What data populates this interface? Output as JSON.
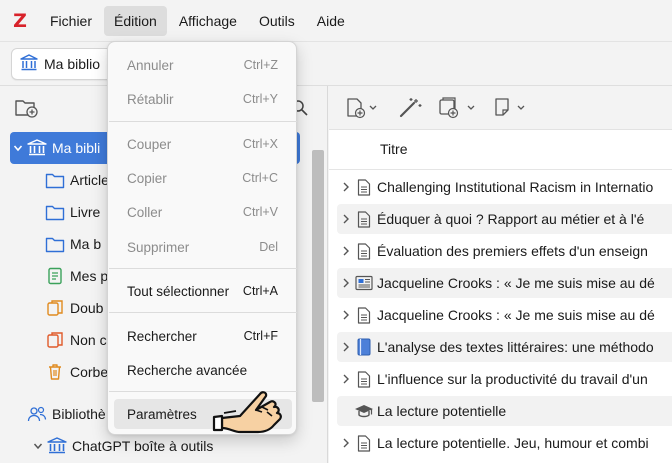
{
  "menubar": {
    "app_logo": "Z",
    "items": [
      {
        "label": "Fichier"
      },
      {
        "label": "Édition"
      },
      {
        "label": "Affichage"
      },
      {
        "label": "Outils"
      },
      {
        "label": "Aide"
      }
    ]
  },
  "tab": {
    "label": "Ma biblio"
  },
  "collections": {
    "items": [
      {
        "label": "Ma bibli",
        "icon": "library-icon"
      },
      {
        "label": "Article",
        "icon": "folder-icon"
      },
      {
        "label": "Livre",
        "icon": "folder-icon"
      },
      {
        "label": "Ma b",
        "icon": "folder-icon"
      },
      {
        "label": "Mes p",
        "icon": "saved-search-icon"
      },
      {
        "label": "Doub",
        "icon": "duplicates-icon"
      },
      {
        "label": "Non c",
        "icon": "unfiled-icon"
      },
      {
        "label": "Corbe",
        "icon": "trash-icon"
      },
      {
        "label": "Bibliothè",
        "icon": "group-libraries-icon"
      },
      {
        "label": "ChatGPT boîte à outils",
        "icon": "library-icon"
      }
    ]
  },
  "items_pane": {
    "column_title": "Titre",
    "rows": [
      {
        "title": "Challenging Institutional Racism in Internatio",
        "icon": "document-icon",
        "expandable": true
      },
      {
        "title": "Éduquer à quoi ? Rapport au métier et à l'é",
        "icon": "document-icon",
        "expandable": true
      },
      {
        "title": "Évaluation des premiers effets d'un enseign",
        "icon": "document-icon",
        "expandable": true
      },
      {
        "title": "Jacqueline Crooks : « Je me suis mise au dé",
        "icon": "newspaper-icon",
        "expandable": true
      },
      {
        "title": "Jacqueline Crooks : « Je me suis mise au dé",
        "icon": "document-icon",
        "expandable": true
      },
      {
        "title": "L'analyse des textes littéraires: une méthodo",
        "icon": "book-icon",
        "expandable": true
      },
      {
        "title": "L'influence sur la productivité du travail d'un",
        "icon": "document-icon",
        "expandable": true
      },
      {
        "title": "La lecture potentielle",
        "icon": "thesis-icon",
        "expandable": false
      },
      {
        "title": "La lecture potentielle. Jeu, humour et combi",
        "icon": "document-icon",
        "expandable": true
      }
    ]
  },
  "edit_menu": {
    "items": [
      {
        "label": "Annuler",
        "shortcut": "Ctrl+Z",
        "enabled": false
      },
      {
        "label": "Rétablir",
        "shortcut": "Ctrl+Y",
        "enabled": false
      },
      {
        "label": "Couper",
        "shortcut": "Ctrl+X",
        "enabled": false
      },
      {
        "label": "Copier",
        "shortcut": "Ctrl+C",
        "enabled": false
      },
      {
        "label": "Coller",
        "shortcut": "Ctrl+V",
        "enabled": false
      },
      {
        "label": "Supprimer",
        "shortcut": "Del",
        "enabled": false
      },
      {
        "label": "Tout sélectionner",
        "shortcut": "Ctrl+A",
        "enabled": true
      },
      {
        "label": "Rechercher",
        "shortcut": "Ctrl+F",
        "enabled": true
      },
      {
        "label": "Recherche avancée",
        "shortcut": "",
        "enabled": true
      },
      {
        "label": "Paramètres",
        "shortcut": "",
        "enabled": true,
        "hovered": true
      }
    ]
  },
  "colors": {
    "accent": "#3f7ad9",
    "brand_red": "#d8222a",
    "icon_blue": "#2f6fd6",
    "icon_green": "#3aa15a",
    "icon_orange": "#e08a1e"
  }
}
